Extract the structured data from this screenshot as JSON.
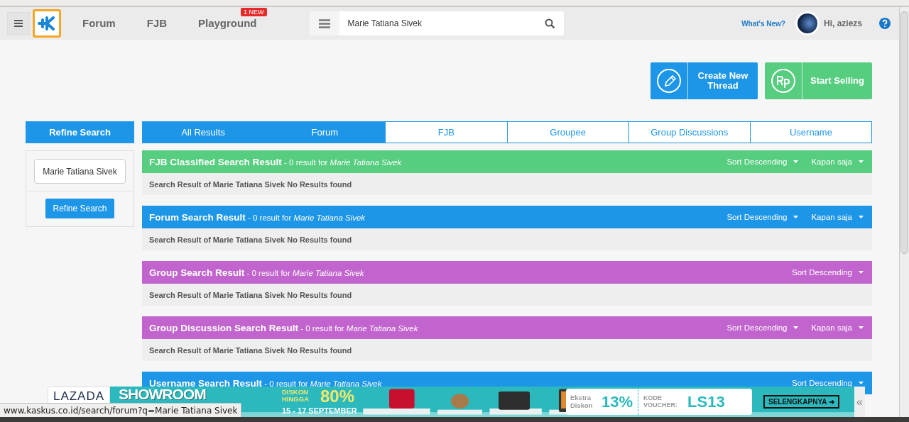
{
  "header": {
    "nav": [
      {
        "label": "Forum"
      },
      {
        "label": "FJB"
      },
      {
        "label": "Playground",
        "badge": "1 NEW"
      }
    ],
    "search": {
      "value": "Marie Tatiana Sivek"
    },
    "whats_new": "What's New?",
    "greeting": "Hi, aziezs"
  },
  "actions": [
    {
      "kind": "pencil",
      "label": "Create New Thread",
      "color": "#1d96e8"
    },
    {
      "kind": "rupiah",
      "label": "Start Selling",
      "color": "#56cd7f"
    }
  ],
  "refine": {
    "title": "Refine Search",
    "value": "Marie Tatiana Sivek",
    "button": "Refine Search"
  },
  "tabs": [
    {
      "label": "All Results",
      "selected": true
    },
    {
      "label": "Forum",
      "selected": true
    },
    {
      "label": "FJB",
      "selected": false
    },
    {
      "label": "Groupee",
      "selected": false
    },
    {
      "label": "Group Discussions",
      "selected": false
    },
    {
      "label": "Username",
      "selected": false
    }
  ],
  "sections": [
    {
      "title": "FJB Classified Search Result",
      "summary": "- 0 result for",
      "query": "Marie Tatiana Sivek",
      "color": "#56cd7f",
      "sort": "Sort Descending",
      "period": "Kapan saja",
      "message": "Search Result of Marie Tatiana Sivek No Results found"
    },
    {
      "title": "Forum Search Result",
      "summary": "- 0 result for",
      "query": "Marie Tatiana Sivek",
      "color": "#1d96e8",
      "sort": "Sort Descending",
      "period": "Kapan saja",
      "message": "Search Result of Marie Tatiana Sivek No Results found"
    },
    {
      "title": "Group Search Result",
      "summary": "- 0 result for",
      "query": "Marie Tatiana Sivek",
      "color": "#c264ce",
      "sort": "Sort Descending",
      "message": "Search Result of Marie Tatiana Sivek No Results found"
    },
    {
      "title": "Group Discussion Search Result",
      "summary": "- 0 result for",
      "query": "Marie Tatiana Sivek",
      "color": "#c264ce",
      "sort": "Sort Descending",
      "period": "Kapan saja",
      "message": "Search Result of Marie Tatiana Sivek No Results found"
    },
    {
      "title": "Username Search Result",
      "summary": "- 0 result for",
      "query": "Marie Tatiana Sivek",
      "color": "#1d96e8",
      "sort": "Sort Descending"
    }
  ],
  "ad_banner": {
    "brand": "LAZADA",
    "headline": "SHOWROOM",
    "discount_label": "DISKON HINGGA",
    "discount": "80%",
    "dates": "15 - 17 SEPTEMBER",
    "extra_label": "Ekstra Diskon",
    "extra": "13%",
    "code_label": "KODE VOUCHER:",
    "code": "LS13",
    "cta": "SELENGKAPNYA ➜",
    "collapse": "«"
  },
  "status_url": "www.kaskus.co.id/search/forum?q=Marie Tatiana Sivek"
}
